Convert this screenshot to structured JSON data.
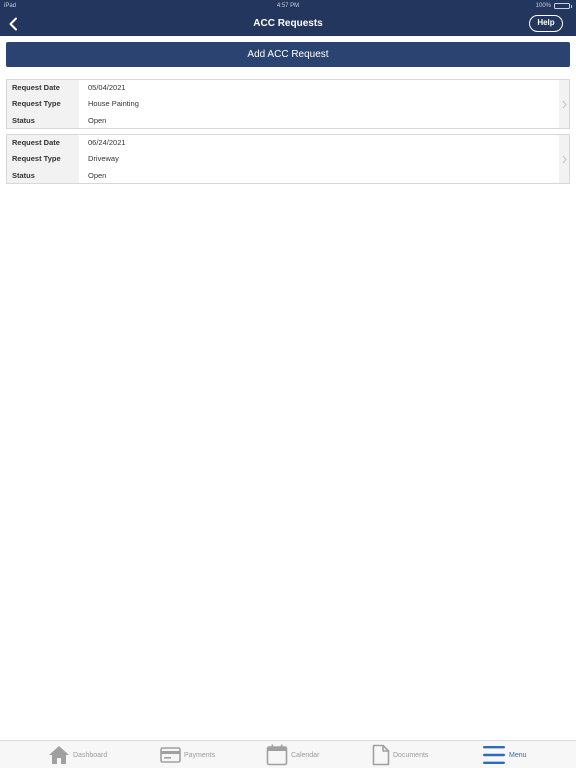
{
  "status_bar": {
    "carrier": "iPad",
    "time": "4:57 PM",
    "battery_text": "100%"
  },
  "nav": {
    "title": "ACC Requests",
    "help_label": "Help",
    "back_icon": "chevron-left-icon"
  },
  "add_button_label": "Add ACC Request",
  "labels": {
    "request_date": "Request Date",
    "request_type": "Request Type",
    "status": "Status"
  },
  "requests": [
    {
      "request_date": "05/04/2021",
      "request_type": "House Painting",
      "status": "Open"
    },
    {
      "request_date": "06/24/2021",
      "request_type": "Driveway",
      "status": "Open"
    }
  ],
  "tabs": [
    {
      "label": "Dashboard",
      "icon": "home-icon",
      "active": false
    },
    {
      "label": "Payments",
      "icon": "credit-card-icon",
      "active": false
    },
    {
      "label": "Calendar",
      "icon": "calendar-icon",
      "active": false
    },
    {
      "label": "Documents",
      "icon": "document-icon",
      "active": false
    },
    {
      "label": "Menu",
      "icon": "menu-icon",
      "active": true
    }
  ],
  "colors": {
    "nav_background": "#23365d",
    "button_background": "#2b4370",
    "active_tab": "#2e6bb8",
    "inactive_tab": "#9a9a9a"
  }
}
